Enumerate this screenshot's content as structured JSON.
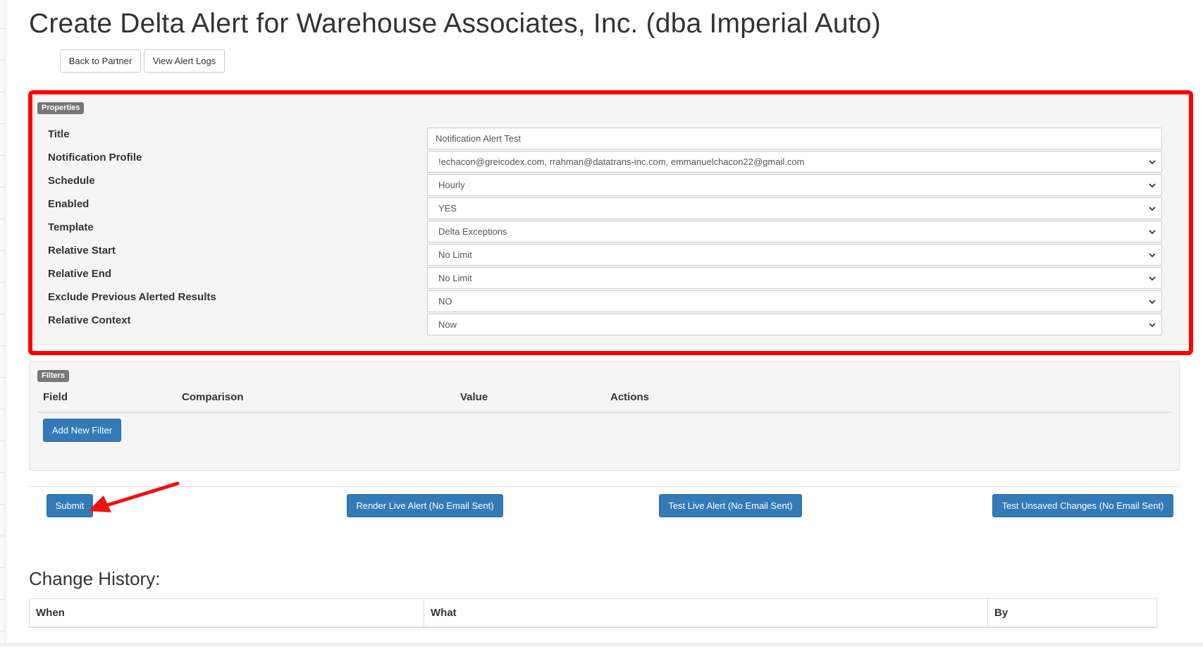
{
  "page": {
    "title": "Create Delta Alert for Warehouse Associates, Inc. (dba Imperial Auto)"
  },
  "nav_buttons": {
    "back": "Back to Partner",
    "logs": "View Alert Logs"
  },
  "properties": {
    "legend": "Properties",
    "title_label": "Title",
    "title_value": "Notification Alert Test",
    "profile_label": "Notification Profile",
    "profile_value": "!echacon@greicodex.com, rrahman@datatrans-inc.com, emmanuelchacon22@gmail.com",
    "schedule_label": "Schedule",
    "schedule_value": "Hourly",
    "enabled_label": "Enabled",
    "enabled_value": "YES",
    "template_label": "Template",
    "template_value": "Delta Exceptions",
    "rel_start_label": "Relative Start",
    "rel_start_value": "No Limit",
    "rel_end_label": "Relative End",
    "rel_end_value": "No Limit",
    "exclude_label": "Exclude Previous Alerted Results",
    "exclude_value": "NO",
    "context_label": "Relative Context",
    "context_value": "Now"
  },
  "filters": {
    "legend": "Filters",
    "columns": [
      "Field",
      "Comparison",
      "Value",
      "Actions"
    ],
    "add_button": "Add New Filter"
  },
  "actions": {
    "submit": "Submit",
    "render_live": "Render Live Alert (No Email Sent)",
    "test_live": "Test Live Alert (No Email Sent)",
    "test_unsaved": "Test Unsaved Changes (No Email Sent)"
  },
  "history": {
    "heading": "Change History:",
    "columns": [
      "When",
      "What",
      "By"
    ]
  },
  "annotations": {
    "highlight_color": "#ff0000",
    "arrow_color": "#ee1111"
  },
  "colors": {
    "primary": "#337ab7",
    "label_badge": "#777777",
    "well": "#f5f5f5"
  }
}
